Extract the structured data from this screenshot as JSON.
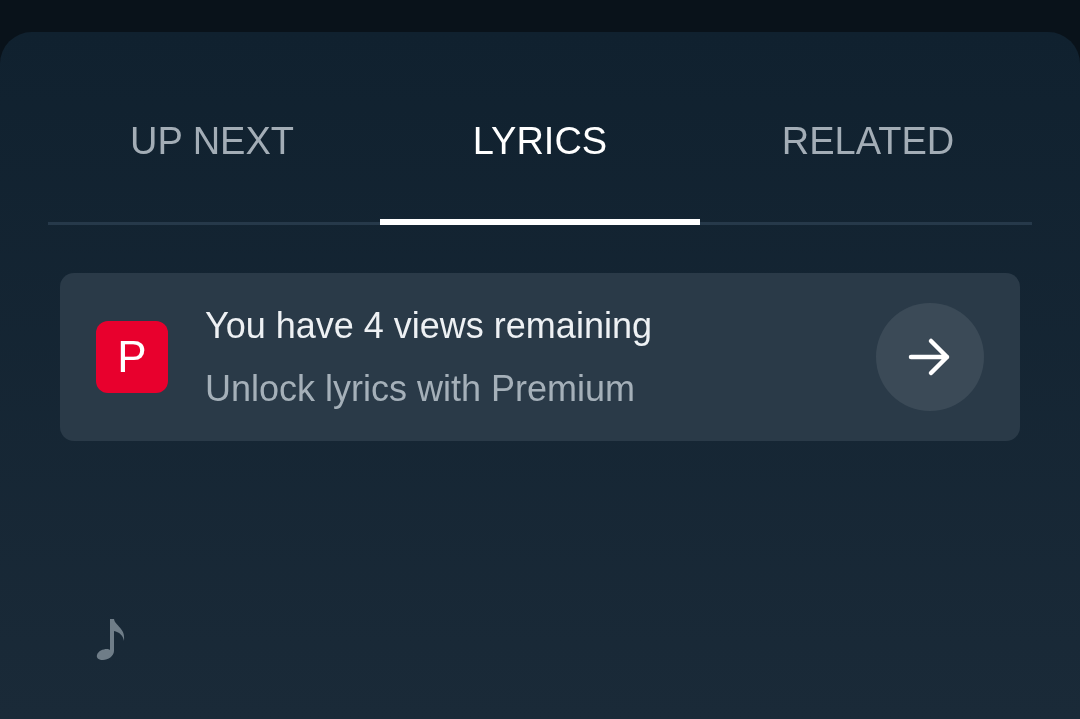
{
  "tabs": [
    {
      "label": "UP NEXT",
      "selected": false
    },
    {
      "label": "LYRICS",
      "selected": true
    },
    {
      "label": "RELATED",
      "selected": false
    }
  ],
  "promo": {
    "logo_letter": "P",
    "title": "You have 4 views remaining",
    "subtitle": "Unlock lyrics with Premium"
  }
}
